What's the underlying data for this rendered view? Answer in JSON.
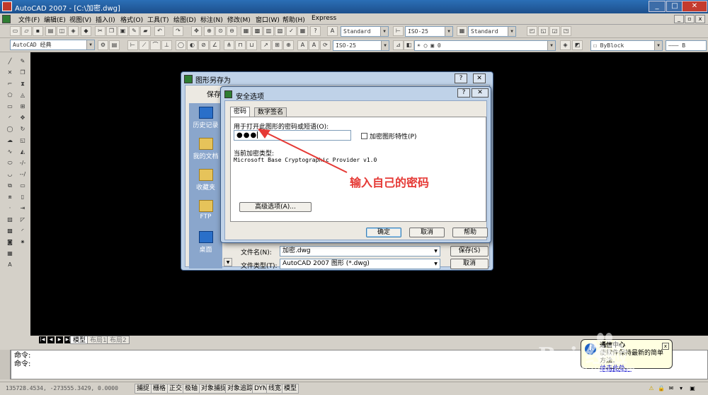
{
  "window": {
    "title": "AutoCAD 2007 - [C:\\加密.dwg]",
    "minimize": "_",
    "restore": "□",
    "close": "✕"
  },
  "menubar": {
    "items": [
      "文件(F)",
      "编辑(E)",
      "视图(V)",
      "插入(I)",
      "格式(O)",
      "工具(T)",
      "绘图(D)",
      "标注(N)",
      "修改(M)",
      "窗口(W)",
      "帮助(H)",
      "Express"
    ],
    "mdi_min": "_",
    "mdi_restore": "▫",
    "mdi_close": "x"
  },
  "toolbar": {
    "text_style": "Standard",
    "dim_style": "ISO-25",
    "table_style": "Standard",
    "workspace": "AutoCAD 经典",
    "dim_style2": "ISO-25",
    "layer": "0",
    "color": "ByBlock",
    "linetype_fragment": "B"
  },
  "layout_tabs": {
    "nav": [
      "|◀",
      "◀",
      "▶",
      "▶|"
    ],
    "tabs": [
      "模型",
      "布局1",
      "布局2"
    ]
  },
  "command_line": {
    "line1": "命令:",
    "line2": "命令:"
  },
  "statusbar": {
    "coords": "135728.4534, -273555.3429, 0.0000",
    "buttons": [
      "捕捉",
      "栅格",
      "正交",
      "极轴",
      "对象捕捉",
      "对象追踪",
      "DYN",
      "线宽",
      "模型"
    ]
  },
  "balloon": {
    "title": "通信中心",
    "text": "使软件保持最新的简单方法。",
    "link": "单击此处。"
  },
  "watermark": {
    "brand": "Bai  经验",
    "url": "jingyan.baidu.com"
  },
  "saveas_dialog": {
    "title": "图形另存为",
    "help": "?",
    "close": "✕",
    "save_in_label": "保存于",
    "places": [
      "历史记录",
      "我的文档",
      "收藏夹",
      "FTP",
      "桌面"
    ],
    "filename_label": "文件名(N):",
    "filename_value": "加密.dwg",
    "filetype_label": "文件类型(T):",
    "filetype_value": "AutoCAD 2007 图形 (*.dwg)",
    "save_button": "保存(S)",
    "cancel_button": "取消"
  },
  "security_dialog": {
    "title": "安全选项",
    "help": "?",
    "close": "✕",
    "tabs": [
      "密码",
      "数字签名"
    ],
    "password_label": "用于打开此图形的密码或短语(O):",
    "password_mask": "●●●",
    "encrypt_props_label": "加密图形特性(P)",
    "encrypt_props_checked": false,
    "enc_type_label": "当前加密类型:",
    "enc_type_value": "Microsoft Base Cryptographic Provider v1.0",
    "advanced_button": "高级选项(A)...",
    "ok_button": "确定",
    "cancel_button": "取消",
    "help_button": "帮助"
  },
  "annotation": {
    "text": "输入自己的密码",
    "color": "#e53935"
  }
}
